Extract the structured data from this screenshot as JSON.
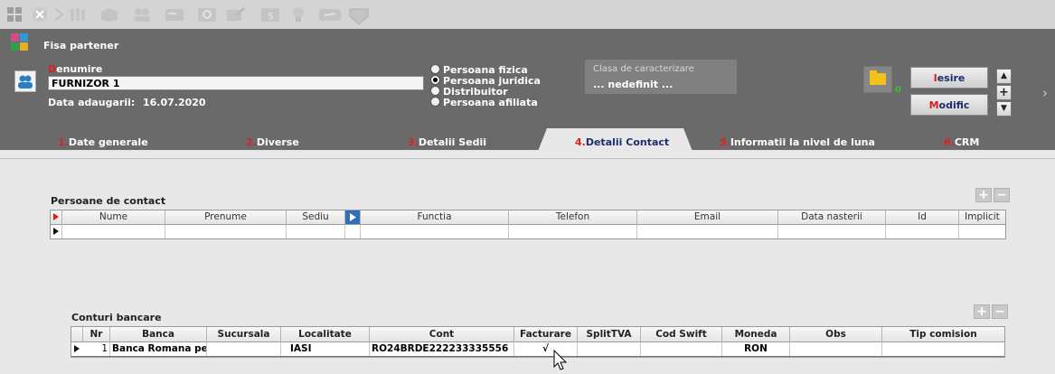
{
  "toolbar": {
    "icons": [
      "grid-icon",
      "close-icon",
      "chevron-right-icon",
      "books-icon",
      "box-icon",
      "users-icon",
      "card-icon",
      "refresh-icon",
      "edit-icon",
      "dollar-icon",
      "lightbulb-icon",
      "link-icon",
      "shield-icon"
    ]
  },
  "header": {
    "title": "Fisa partener",
    "denumire_label_first": "D",
    "denumire_label_rest": "enumire",
    "denumire_value": "FURNIZOR 1",
    "data_label": "Data adaugarii:",
    "data_value": "16.07.2020",
    "radios": [
      {
        "label": "Persoana fizica",
        "selected": false
      },
      {
        "label": "Persoana juridica",
        "selected": true
      },
      {
        "label": "Distribuitor",
        "selected": false
      },
      {
        "label": "Persoana afiliata",
        "selected": false
      }
    ],
    "clasa_label": "Clasa de caracterizare",
    "clasa_value": "... nedefinit ...",
    "folder_count": "0",
    "iesire_hot": "I",
    "iesire_rest": "esire",
    "modific_hot": "M",
    "modific_rest": "odific",
    "nav_up": "▲",
    "nav_add": "+",
    "nav_down": "▼",
    "right_chevron": "›"
  },
  "tabs": [
    {
      "num": "1.",
      "label": "Date generale",
      "active": false
    },
    {
      "num": "2.",
      "label": "Diverse",
      "active": false
    },
    {
      "num": "3.",
      "label": "Detalii Sedii",
      "active": false
    },
    {
      "num": "4.",
      "label": "Detalii Contact",
      "active": true
    },
    {
      "num": "5.",
      "label": "Informatii la nivel de luna",
      "active": false
    },
    {
      "num": "6.",
      "label": "CRM",
      "active": false
    }
  ],
  "contacts": {
    "title": "Persoane de contact",
    "add": "+",
    "remove": "−",
    "columns": [
      "Nume",
      "Prenume",
      "Sediu",
      "Functia",
      "Telefon",
      "Email",
      "Data nasterii",
      "Id",
      "Implicit"
    ]
  },
  "bank": {
    "title": "Conturi bancare",
    "add": "+",
    "remove": "−",
    "columns": [
      "Nr",
      "Banca",
      "Sucursala",
      "Localitate",
      "Cont",
      "Facturare",
      "SplitTVA",
      "Cod Swift",
      "Moneda",
      "Obs",
      "Tip comision"
    ],
    "rows": [
      {
        "nr": "1",
        "banca": "Banca Romana pen",
        "sucursala": "",
        "localitate": "IASI",
        "cont": "RO24BRDE222233335556",
        "facturare": "√",
        "splittva": "",
        "cod_swift": "",
        "moneda": "RON",
        "obs": "",
        "tip_comision": ""
      }
    ]
  },
  "colors": {
    "header_bg": "#6a6a6a",
    "content_bg": "#e8e8e8",
    "accent_red": "#e02020",
    "button_text": "#1b2f6e"
  }
}
